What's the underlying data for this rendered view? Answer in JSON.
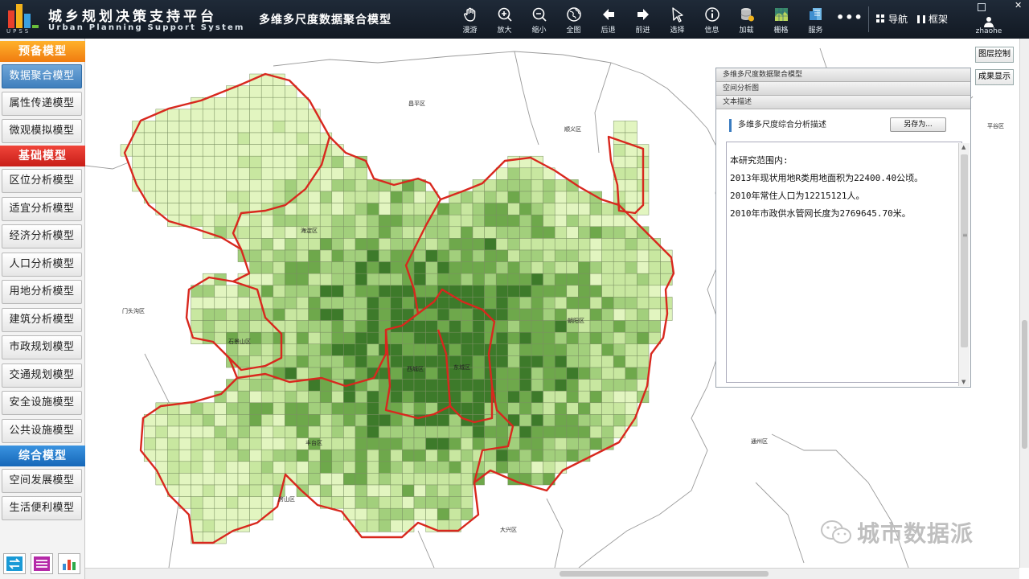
{
  "app": {
    "title": "城乡规划决策支持平台",
    "subtitle": "Urban Planning Support System",
    "logo_text": "UPSS",
    "model_title": "多维多尺度数据聚合模型"
  },
  "toolbar": [
    {
      "label": "漫游",
      "icon": "hand-icon"
    },
    {
      "label": "放大",
      "icon": "zoom-in-icon"
    },
    {
      "label": "缩小",
      "icon": "zoom-out-icon"
    },
    {
      "label": "全图",
      "icon": "globe-icon"
    },
    {
      "label": "后退",
      "icon": "arrow-left-icon"
    },
    {
      "label": "前进",
      "icon": "arrow-right-icon"
    },
    {
      "label": "选择",
      "icon": "cursor-icon"
    },
    {
      "label": "信息",
      "icon": "info-icon"
    },
    {
      "label": "加载",
      "icon": "database-icon"
    },
    {
      "label": "栅格",
      "icon": "raster-icon"
    },
    {
      "label": "服务",
      "icon": "server-icon"
    }
  ],
  "topright": {
    "more": "•••",
    "nav": "导航",
    "frame": "框架",
    "user": "zhaohe"
  },
  "sidebar": {
    "sections": [
      {
        "title": "预备模型",
        "items": [
          "数据聚合模型",
          "属性传递模型",
          "微观模拟模型"
        ]
      },
      {
        "title": "基础模型",
        "items": [
          "区位分析模型",
          "适宜分析模型",
          "经济分析模型",
          "人口分析模型",
          "用地分析模型",
          "建筑分析模型",
          "市政规划模型",
          "交通规划模型",
          "安全设施模型",
          "公共设施模型"
        ]
      },
      {
        "title": "综合模型",
        "items": [
          "空间发展模型",
          "生活便利模型"
        ]
      }
    ],
    "active_item": "数据聚合模型"
  },
  "map": {
    "districts": [
      {
        "name": "昌平区"
      },
      {
        "name": "顺义区"
      },
      {
        "name": "平谷区"
      },
      {
        "name": "海淀区"
      },
      {
        "name": "门头沟区"
      },
      {
        "name": "石景山区"
      },
      {
        "name": "朝阳区"
      },
      {
        "name": "西城区"
      },
      {
        "name": "东城区"
      },
      {
        "name": "丰台区"
      },
      {
        "name": "通州区"
      },
      {
        "name": "房山区"
      },
      {
        "name": "大兴区"
      }
    ],
    "layer_control": "图层控制",
    "result_display": "成果显示",
    "colors": {
      "boundary": "#d8281e",
      "grid_levels": [
        "#e2f5c0",
        "#c8e7a0",
        "#a2cf7c",
        "#6ea84b",
        "#3d7a2a"
      ]
    }
  },
  "panel": {
    "header1": "多维多尺度数据聚合模型",
    "header2": "空间分析图",
    "header3": "文本描述",
    "heading": "多维多尺度综合分析描述",
    "save_as": "另存为...",
    "lines": [
      "本研究范围内:",
      "2013年现状用地R类用地面积为22400.40公顷。",
      "2010年常住人口为12215121人。",
      "2010年市政供水管网长度为2769645.70米。"
    ]
  },
  "watermark": "城市数据派"
}
